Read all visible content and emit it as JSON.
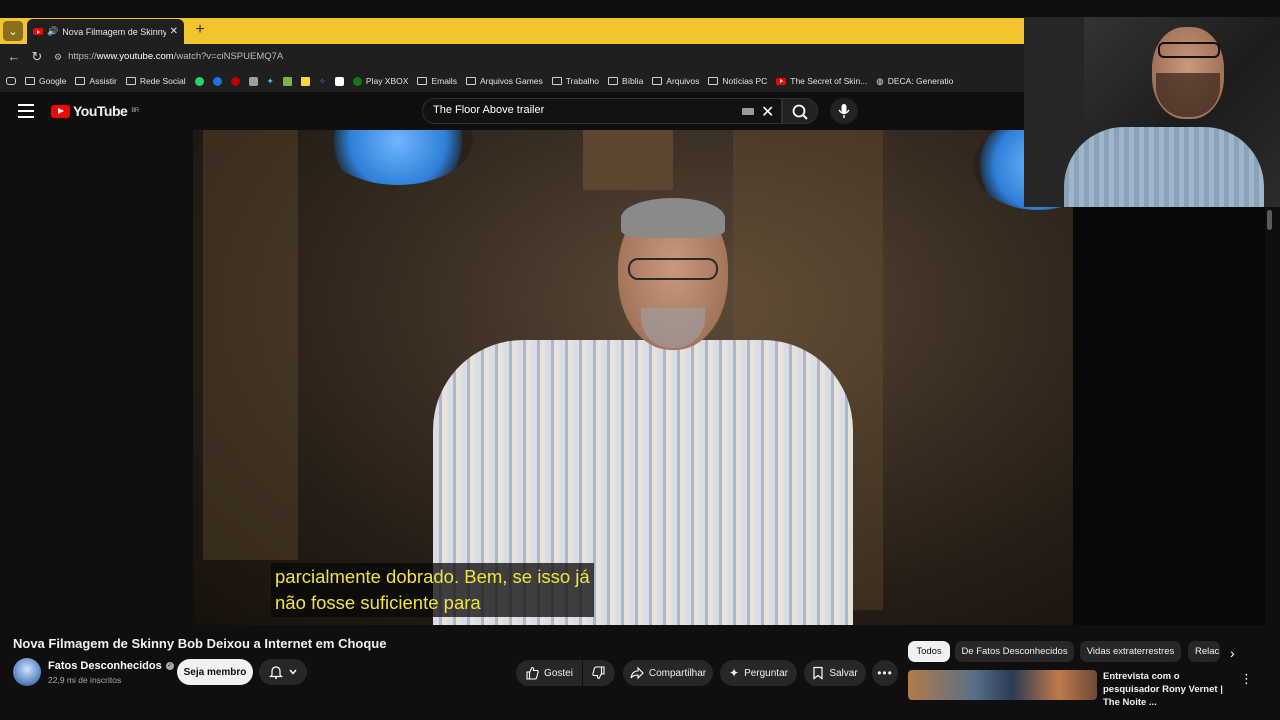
{
  "browser": {
    "tab_title": "Nova Filmagem de Skinny Bob Deixou a Internet em Choque",
    "new_tab_label": "+",
    "url_prefix": "https://",
    "url_host": "www.youtube.com",
    "url_path": "/watch?v=ciNSPUEMQ7A",
    "bookmarks": [
      {
        "label": "Google",
        "icon": "folder-icon"
      },
      {
        "label": "Assistir",
        "icon": "folder-icon"
      },
      {
        "label": "Rede Social",
        "icon": "folder-icon"
      },
      {
        "label": "Play XBOX",
        "icon": "xbox-icon"
      },
      {
        "label": "Emails",
        "icon": "folder-icon"
      },
      {
        "label": "Arquivos Games",
        "icon": "folder-icon"
      },
      {
        "label": "Trabalho",
        "icon": "folder-icon"
      },
      {
        "label": "Bíblia",
        "icon": "folder-icon"
      },
      {
        "label": "Arquivos",
        "icon": "folder-icon"
      },
      {
        "label": "Notícias PC",
        "icon": "folder-icon"
      },
      {
        "label": "The Secret of Skin...",
        "icon": "youtube-icon"
      },
      {
        "label": "DECA: Generatio",
        "icon": "globe-icon"
      }
    ]
  },
  "youtube": {
    "logo_text": "YouTube",
    "logo_region": "BR",
    "search_query": "The Floor Above trailer",
    "caption_line_1": "parcialmente dobrado. Bem, se isso já",
    "caption_line_2": "não fosse suficiente para",
    "video_title": "Nova Filmagem de Skinny Bob Deixou a Internet em Choque",
    "channel_name": "Fatos Desconhecidos",
    "subscribers": "22,9 mi de inscritos",
    "member_button": "Seja membro",
    "like_label": "Gostei",
    "share_label": "Compartilhar",
    "ask_label": "Perguntar",
    "save_label": "Salvar",
    "chips": [
      "Todos",
      "De Fatos Desconhecidos",
      "Vidas extraterrestres",
      "Relac"
    ],
    "recommendation_title": "Entrevista com o pesquisador Rony Vernet | The Noite ..."
  },
  "colors": {
    "tabstrip": "#f4c430",
    "caption_text": "#f2e33c",
    "youtube_red": "#ff0000"
  }
}
